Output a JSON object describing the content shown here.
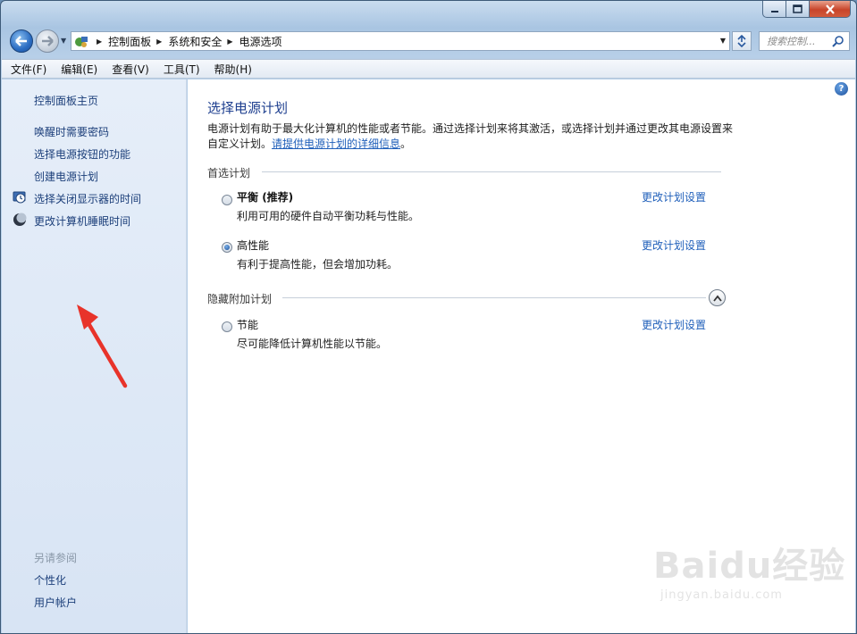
{
  "window": {
    "controls": {
      "minimize": "–",
      "maximize": "□",
      "close": "✕"
    }
  },
  "address": {
    "crumbs": [
      "控制面板",
      "系统和安全",
      "电源选项"
    ],
    "search_placeholder": "搜索控制..."
  },
  "menu": [
    "文件(F)",
    "编辑(E)",
    "查看(V)",
    "工具(T)",
    "帮助(H)"
  ],
  "sidebar": {
    "home": "控制面板主页",
    "links": [
      "唤醒时需要密码",
      "选择电源按钮的功能",
      "创建电源计划",
      "选择关闭显示器的时间",
      "更改计算机睡眠时间"
    ],
    "see_also_label": "另请参阅",
    "see_also": [
      "个性化",
      "用户帐户"
    ]
  },
  "main": {
    "title": "选择电源计划",
    "intro_text": "电源计划有助于最大化计算机的性能或者节能。通过选择计划来将其激活，或选择计划并通过更改其电源设置来自定义计划。",
    "intro_link": "请提供电源计划的详细信息",
    "intro_end": "。",
    "preferred_label": "首选计划",
    "hidden_label": "隐藏附加计划",
    "change_link": "更改计划设置",
    "plans": [
      {
        "name": "平衡",
        "suffix": " (推荐)",
        "desc": "利用可用的硬件自动平衡功耗与性能。",
        "checked": false
      },
      {
        "name": "高性能",
        "suffix": "",
        "desc": "有利于提高性能，但会增加功耗。",
        "checked": true
      },
      {
        "name": "节能",
        "suffix": "",
        "desc": "尽可能降低计算机性能以节能。",
        "checked": false
      }
    ]
  },
  "watermark": {
    "brand": "Baidu经验",
    "url": "jingyan.baidu.com"
  }
}
